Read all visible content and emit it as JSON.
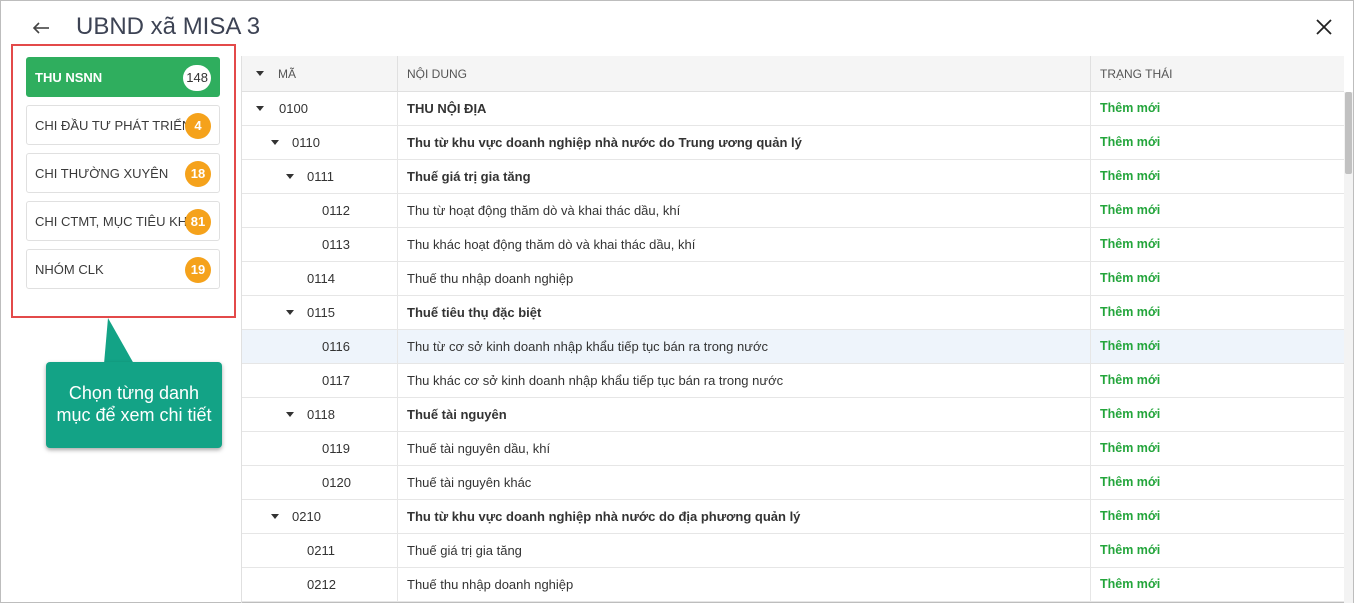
{
  "header": {
    "title": "UBND xã MISA 3"
  },
  "sidebar": {
    "categories": [
      {
        "label": "THU NSNN",
        "count": "148",
        "active": true
      },
      {
        "label": "CHI ĐẦU TƯ PHÁT TRIỂN",
        "count": "4",
        "active": false
      },
      {
        "label": "CHI THƯỜNG XUYÊN",
        "count": "18",
        "active": false
      },
      {
        "label": "CHI CTMT, MỤC TIÊU KHÁC",
        "count": "81",
        "active": false
      },
      {
        "label": "NHÓM CLK",
        "count": "19",
        "active": false
      }
    ]
  },
  "callout": {
    "line1": "Chọn từng danh",
    "line2": "mục để xem chi tiết"
  },
  "table": {
    "columns": {
      "code": "MÃ",
      "content": "NỘI DUNG",
      "status": "TRẠNG THÁI"
    },
    "rows": [
      {
        "code": "0100",
        "content": "THU NỘI ĐỊA",
        "status": "Thêm mới",
        "level": 0,
        "expandable": true
      },
      {
        "code": "0110",
        "content": "Thu từ khu vực doanh nghiệp nhà nước do Trung ương quản lý",
        "status": "Thêm mới",
        "level": 1,
        "expandable": true
      },
      {
        "code": "0111",
        "content": "Thuế giá trị gia tăng",
        "status": "Thêm mới",
        "level": 2,
        "expandable": true
      },
      {
        "code": "0112",
        "content": "Thu từ hoạt động thăm dò và khai thác dầu, khí",
        "status": "Thêm mới",
        "level": 3,
        "expandable": false
      },
      {
        "code": "0113",
        "content": "Thu khác hoạt động thăm dò và khai thác dầu, khí",
        "status": "Thêm mới",
        "level": 3,
        "expandable": false
      },
      {
        "code": "0114",
        "content": "Thuế thu nhập doanh nghiệp",
        "status": "Thêm mới",
        "level": 2,
        "expandable": false
      },
      {
        "code": "0115",
        "content": "Thuế tiêu thụ đặc biệt",
        "status": "Thêm mới",
        "level": 2,
        "expandable": true
      },
      {
        "code": "0116",
        "content": "Thu từ cơ sở kinh doanh nhập khẩu tiếp tục bán ra trong nước",
        "status": "Thêm mới",
        "level": 3,
        "expandable": false,
        "highlight": true
      },
      {
        "code": "0117",
        "content": "Thu khác cơ sở kinh doanh nhập khẩu tiếp tục bán ra trong nước",
        "status": "Thêm mới",
        "level": 3,
        "expandable": false
      },
      {
        "code": "0118",
        "content": "Thuế tài nguyên",
        "status": "Thêm mới",
        "level": 2,
        "expandable": true
      },
      {
        "code": "0119",
        "content": "Thuế tài nguyên dầu, khí",
        "status": "Thêm mới",
        "level": 3,
        "expandable": false
      },
      {
        "code": "0120",
        "content": "Thuế tài nguyên khác",
        "status": "Thêm mới",
        "level": 3,
        "expandable": false
      },
      {
        "code": "0210",
        "content": "Thu từ khu vực doanh nghiệp nhà nước do địa phương quản lý",
        "status": "Thêm mới",
        "level": 1,
        "expandable": true
      },
      {
        "code": "0211",
        "content": "Thuế giá trị gia tăng",
        "status": "Thêm mới",
        "level": 2,
        "expandable": false
      },
      {
        "code": "0212",
        "content": "Thuế thu nhập doanh nghiệp",
        "status": "Thêm mới",
        "level": 2,
        "expandable": false
      }
    ]
  },
  "colors": {
    "accent_green": "#2fae5e",
    "badge_orange": "#f5a21b",
    "status_green": "#23a53b",
    "callout_teal": "#13a386",
    "highlight_border": "#e34a4a"
  },
  "icons": {
    "back": "arrow-left-icon",
    "close": "close-icon",
    "expand": "caret-down-icon"
  }
}
